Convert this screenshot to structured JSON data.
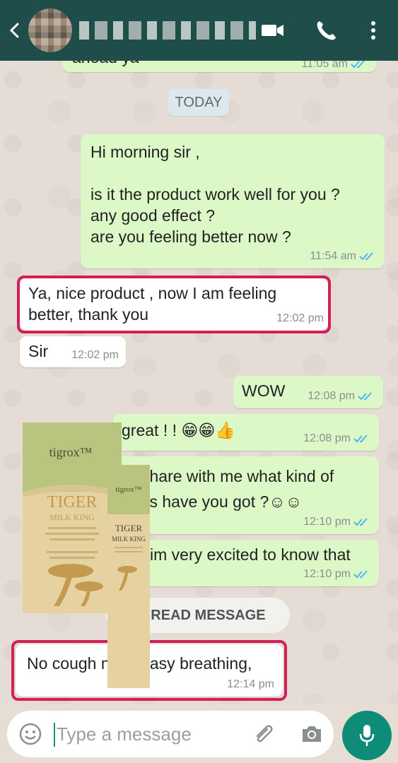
{
  "header": {
    "contact_name": "",
    "back": "back-icon",
    "icons": [
      "video-call-icon",
      "voice-call-icon",
      "more-options-icon"
    ]
  },
  "chat": {
    "partial_top_text": "ahead ya",
    "partial_top_time": "11:05 am",
    "date_label": "TODAY",
    "messages": [
      {
        "direction": "out",
        "text": "Hi morning sir ,\n\nis it the product work well for you ?\nany good effect ?\nare you feeling better now ?",
        "time": "11:54 am",
        "read": true
      },
      {
        "direction": "in",
        "text": "Ya,  nice product , now I am feeling\nbetter,  thank you",
        "time": "12:02 pm"
      },
      {
        "direction": "in",
        "text": "Sir",
        "time": "12:02 pm"
      },
      {
        "direction": "out",
        "text": "WOW",
        "time": "12:08 pm",
        "read": true
      },
      {
        "direction": "out",
        "text": "great  !  !  😁😁👍",
        "time": "12:08 pm",
        "read": true
      },
      {
        "direction": "out",
        "text": "share with me what kind of\nlts have you got  ?☺☺",
        "time": "12:10 pm",
        "read": true
      },
      {
        "direction": "out",
        "text": "im very excited to know that",
        "time": "12:10 pm",
        "read": true
      },
      {
        "direction": "in",
        "text": "No cough now.  Easy breathing,",
        "time": "12:14 pm"
      }
    ],
    "unread_label": "UNREAD MESSAGE"
  },
  "product": {
    "brand": "tigrox™",
    "name_line1": "TIGER",
    "name_line2": "MILK KING",
    "box_color": "#e6d2a1",
    "top_color": "#b9c47e",
    "accent": "#c39a4f"
  },
  "input": {
    "placeholder": "Type a message"
  },
  "colors": {
    "header": "#1f4d4a",
    "outgoing": "#dcf8c6",
    "incoming": "#ffffff",
    "highlight": "#d21f55",
    "mic": "#0f8c77",
    "ticks": "#4fb6ec"
  }
}
